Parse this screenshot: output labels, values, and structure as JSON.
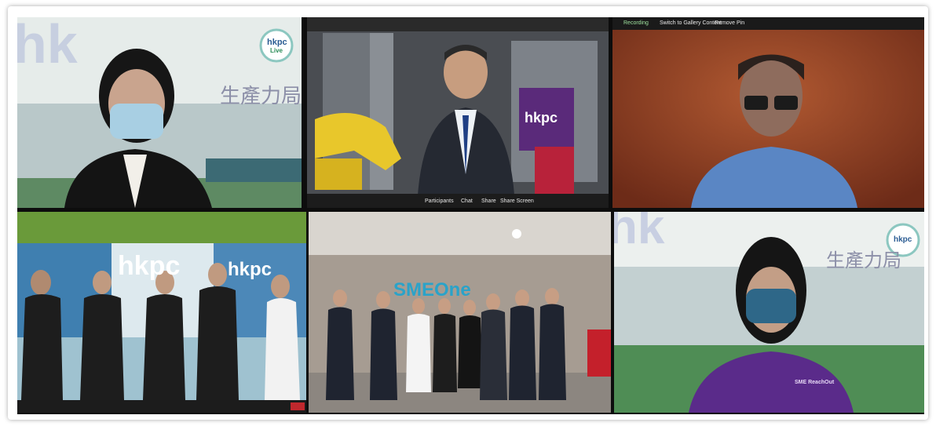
{
  "tiles": [
    {
      "backdrop_text": "生產力局",
      "logo": "hkpc",
      "logo_sub": "Live"
    },
    {
      "logo": "hkpc",
      "toolbar": [
        "Participants",
        "Chat",
        "Share",
        "Share Screen"
      ]
    },
    {
      "header": [
        "Recording",
        "Switch to Gallery Content",
        "Remove Pin"
      ]
    },
    {
      "logo": "hkpc",
      "banner": "hkpc"
    },
    {
      "logo": "SMEOne"
    },
    {
      "backdrop_text": "生產力局",
      "logo": "hkpc",
      "shirt_text": "SME ReachOut"
    }
  ],
  "colors": {
    "hkpc_purple": "#5b2a86",
    "background": "#ffffff"
  }
}
